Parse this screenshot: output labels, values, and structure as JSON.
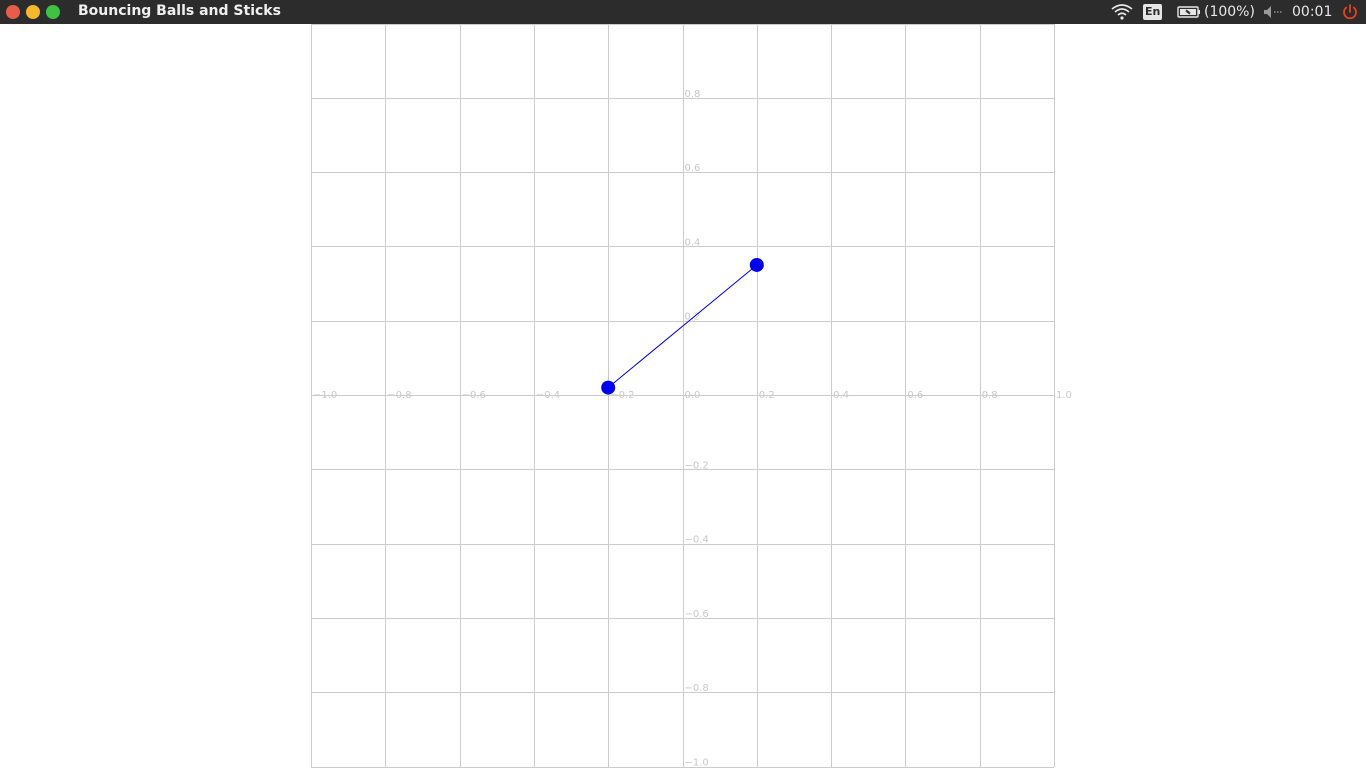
{
  "window": {
    "title": "Bouncing Balls and Sticks"
  },
  "tray": {
    "language": "En",
    "battery": "(100%)",
    "clock": "00:01"
  },
  "icons": {
    "close": "close-icon",
    "minimize": "minimize-icon",
    "maximize": "maximize-icon",
    "wifi": "wifi-icon",
    "battery": "battery-icon",
    "volume": "volume-muted-icon",
    "power": "power-icon"
  },
  "colors": {
    "ball": "#0000ee",
    "stick": "#0000ee",
    "grid": "#cccccc",
    "tick_text": "#c8c8c8",
    "power": "#e8421c"
  },
  "chart_data": {
    "type": "scatter",
    "xlim": [
      -1.0,
      1.0
    ],
    "ylim": [
      -1.0,
      1.0
    ],
    "grid": true,
    "x_ticks": [
      "−1.0",
      "−0.8",
      "−0.6",
      "−0.4",
      "−0.2",
      "0.0",
      "0.2",
      "0.4",
      "0.6",
      "0.8",
      "1.0"
    ],
    "y_ticks": [
      "0.8",
      "0.6",
      "0.4",
      "0.2",
      "−0.2",
      "−0.4",
      "−0.6",
      "−0.8",
      "−1.0"
    ],
    "balls": [
      {
        "x": -0.2,
        "y": 0.02
      },
      {
        "x": 0.2,
        "y": 0.35
      }
    ],
    "sticks": [
      {
        "from": 0,
        "to": 1
      }
    ]
  }
}
